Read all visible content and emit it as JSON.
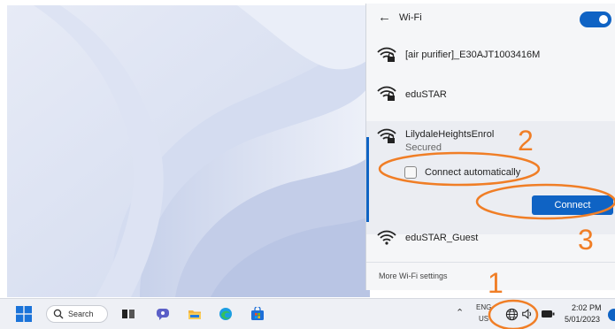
{
  "flyout": {
    "title": "Wi-Fi",
    "back_icon": "back-arrow-icon",
    "toggle_state": "on",
    "networks": [
      {
        "name": "[air purifier]_E30AJT1003416M",
        "icon": "wifi-secured-icon"
      },
      {
        "name": "eduSTAR",
        "icon": "wifi-secured-icon"
      },
      {
        "name": "LilydaleHeightsEnrol",
        "icon": "wifi-secured-icon",
        "status": "Secured",
        "auto_connect_label": "Connect automatically",
        "connect_label": "Connect"
      },
      {
        "name": "eduSTAR_Guest",
        "icon": "wifi-open-icon"
      }
    ],
    "more_settings": "More Wi-Fi settings"
  },
  "taskbar": {
    "search_label": "Search",
    "language_top": "ENG",
    "language_bottom": "US",
    "time": "2:02 PM",
    "date": "5/01/2023"
  },
  "annotations": {
    "step1": "1",
    "step2": "2",
    "step3": "3"
  },
  "colors": {
    "accent": "#0f63c4",
    "annotation": "#f07e26"
  }
}
